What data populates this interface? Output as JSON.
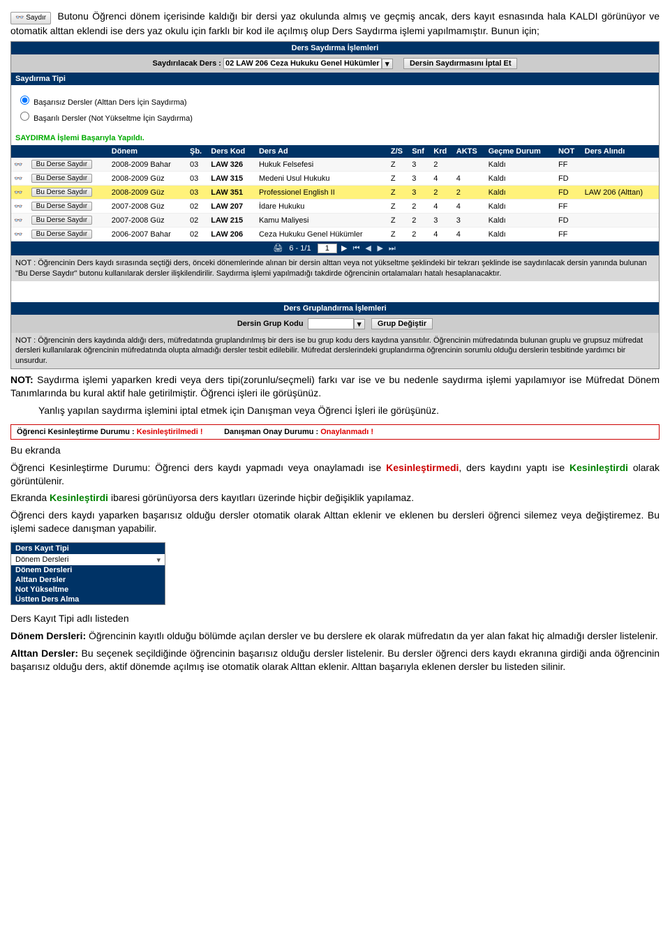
{
  "intro": {
    "btn_label": "Saydır",
    "text": " Butonu Öğrenci dönem içerisinde kaldığı bir dersi yaz okulunda almış ve geçmiş ancak, ders kayıt esnasında hala KALDI görünüyor ve otomatik alttan eklendi ise ders yaz okulu için farklı bir kod ile açılmış olup Ders Saydırma işlemi yapılmamıştır. Bunun için;"
  },
  "app": {
    "title": "Ders Saydırma İşlemleri",
    "topbar": {
      "label": "Saydırılacak Ders :",
      "selected": "02 LAW 206 Ceza Hukuku Genel Hükümler",
      "cancel_btn": "Dersin Saydırmasını İptal Et"
    },
    "saydirma_tipi": {
      "header": "Saydırma Tipi",
      "opt1": "Başarısız Dersler (Alttan Ders İçin Saydırma)",
      "opt2": "Başarılı Dersler (Not Yükseltme İçin Saydırma)"
    },
    "success": "SAYDIRMA İşlemi Başarıyla Yapıldı.",
    "headers": [
      "",
      "",
      "Dönem",
      "Şb.",
      "Ders Kod",
      "Ders Ad",
      "Z/S",
      "Snf",
      "Krd",
      "AKTS",
      "Geçme Durum",
      "NOT",
      "Ders Alındı"
    ],
    "rows": [
      {
        "btn": "Bu Derse Saydır",
        "donem": "2008-2009 Bahar",
        "sb": "03",
        "kod": "LAW 326",
        "ad": "Hukuk Felsefesi",
        "zs": "Z",
        "snf": "3",
        "krd": "2",
        "akts": "",
        "durum": "Kaldı",
        "not": "FF",
        "alindi": ""
      },
      {
        "btn": "Bu Derse Saydır",
        "donem": "2008-2009 Güz",
        "sb": "03",
        "kod": "LAW 315",
        "ad": "Medeni Usul Hukuku",
        "zs": "Z",
        "snf": "3",
        "krd": "4",
        "akts": "4",
        "durum": "Kaldı",
        "not": "FD",
        "alindi": ""
      },
      {
        "btn": "Bu Derse Saydır",
        "donem": "2008-2009 Güz",
        "sb": "03",
        "kod": "LAW 351",
        "ad": "Professionel English II",
        "zs": "Z",
        "snf": "3",
        "krd": "2",
        "akts": "2",
        "durum": "Kaldı",
        "not": "FD",
        "alindi": "LAW 206 (Alttan)",
        "hl": true
      },
      {
        "btn": "Bu Derse Saydır",
        "donem": "2007-2008 Güz",
        "sb": "02",
        "kod": "LAW 207",
        "ad": "İdare Hukuku",
        "zs": "Z",
        "snf": "2",
        "krd": "4",
        "akts": "4",
        "durum": "Kaldı",
        "not": "FF",
        "alindi": ""
      },
      {
        "btn": "Bu Derse Saydır",
        "donem": "2007-2008 Güz",
        "sb": "02",
        "kod": "LAW 215",
        "ad": "Kamu Maliyesi",
        "zs": "Z",
        "snf": "2",
        "krd": "3",
        "akts": "3",
        "durum": "Kaldı",
        "not": "FD",
        "alindi": ""
      },
      {
        "btn": "Bu Derse Saydır",
        "donem": "2006-2007 Bahar",
        "sb": "02",
        "kod": "LAW 206",
        "ad": "Ceza Hukuku Genel Hükümler",
        "zs": "Z",
        "snf": "2",
        "krd": "4",
        "akts": "4",
        "durum": "Kaldı",
        "not": "FF",
        "alindi": ""
      }
    ],
    "pager": {
      "range": "6 - 1/1",
      "page": "1"
    },
    "note1": "NOT : Öğrencinin Ders kaydı sırasında seçtiği ders, önceki dönemlerinde alınan bir dersin alttan veya not yükseltme şeklindeki bir tekrarı şeklinde ise saydırılacak dersin yanında bulunan \"Bu Derse Saydır\" butonu kullanılarak dersler ilişkilendirilir. Saydırma işlemi yapılmadığı takdirde öğrencinin ortalamaları hatalı hesaplanacaktır.",
    "group_title": "Ders Gruplandırma İşlemleri",
    "group_bar": {
      "label": "Dersin Grup Kodu",
      "selected": "",
      "btn": "Grup Değiştir"
    },
    "note2": "NOT : Öğrencinin ders kaydında aldığı ders, müfredatında gruplandırılmış bir ders ise bu grup kodu ders kaydına yansıtılır. Öğrencinin müfredatında bulunan gruplu ve grupsuz müfredat dersleri kullanılarak öğrencinin müfredatında olupta almadığı dersler tesbit edilebilir. Müfredat derslerindeki gruplandırma öğrencinin sorumlu olduğu derslerin tesbitinde yardımcı bir unsurdur."
  },
  "body": {
    "not_para": "Saydırma işlemi yaparken kredi veya ders tipi(zorunlu/seçmeli) farkı var ise ve bu nedenle saydırma işlemi yapılamıyor ise Müfredat Dönem Tanımlarında bu kural aktif hale getirilmiştir. Öğrenci işleri ile görüşünüz.",
    "not_prefix": "NOT: ",
    "yanlis": "Yanlış yapılan saydırma işlemini iptal etmek için Danışman veya Öğrenci İşleri ile görüşünüz.",
    "status": {
      "l1a": "Öğrenci Kesinleştirme Durumu : ",
      "l1b": "Kesinleştirilmedi !",
      "l2a": "Danışman Onay Durumu : ",
      "l2b": "Onaylanmadı !"
    },
    "bu_ekranda": "Bu ekranda",
    "kd1a": "Öğrenci Kesinleştirme Durumu: Öğrenci ders kaydı yapmadı veya onaylamadı ise ",
    "kd1b": "Kesinleştirmedi",
    "kd1c": ", ders kaydını yaptı ise ",
    "kd1d": "Kesinleştirdi",
    "kd1e": " olarak görüntülenir.",
    "ek_a": "Ekranda ",
    "ek_b": "Kesinleştirdi",
    "ek_c": " ibaresi görünüyorsa ders kayıtları üzerinde hiçbir değişiklik yapılamaz.",
    "auto": "Öğrenci ders kaydı yaparken başarısız olduğu dersler otomatik olarak Alttan eklenir ve eklenen bu dersleri öğrenci silemez veya değiştiremez. Bu işlemi sadece danışman yapabilir.",
    "dk_listeden": "Ders Kayıt Tipi adlı listeden",
    "dk_head": "Ders Kayıt Tipi",
    "dk_sel": "Dönem Dersleri",
    "dk_items": [
      "Dönem Dersleri",
      "Alttan Dersler",
      "Not Yükseltme",
      "Üstten Ders Alma"
    ],
    "donem_title": "Dönem Dersleri: ",
    "donem_text": "Öğrencinin kayıtlı olduğu bölümde açılan dersler ve bu derslere ek olarak müfredatın da yer alan fakat hiç almadığı dersler listelenir.",
    "alttan_title": "Alttan Dersler: ",
    "alttan_text": "Bu seçenek seçildiğinde öğrencinin başarısız olduğu dersler listelenir. Bu dersler öğrenci ders kaydı ekranına girdiği anda öğrencinin başarısız olduğu ders, aktif dönemde açılmış ise otomatik olarak Alttan eklenir. Alttan başarıyla eklenen dersler bu listeden silinir.",
    "eyeglasses": "👓"
  }
}
